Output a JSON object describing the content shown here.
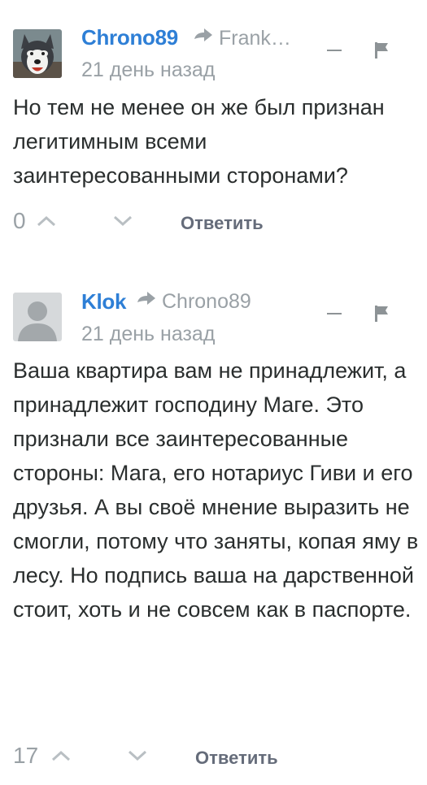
{
  "comments": [
    {
      "author": "Chrono89",
      "reply_to": "Frank…",
      "timestamp": "21 день назад",
      "text": "Но тем не менее он же был признан легитимным всеми заинтересованными сторонами?",
      "votes": "0",
      "reply_label": "Ответить",
      "avatar_icon": "husky-dog-avatar"
    },
    {
      "author": "Klok",
      "reply_to": "Chrono89",
      "timestamp": "21 день назад",
      "text": "Ваша квартира вам не принадлежит, а принадлежит господину Маге. Это признали все заинтересованные стороны: Мага, его нотариус Гиви и его друзья. А вы своё мнение выразить не смогли, потому что заняты, копая яму в лесу. Но подпись ваша на дарственной стоит, хоть и не совсем как в паспорте.",
      "votes": "17",
      "reply_label": "Ответить",
      "avatar_icon": "default-user-avatar"
    }
  ],
  "colors": {
    "author": "#2e7fd6",
    "muted": "#9aa1a6",
    "text": "#2a2e2e",
    "action": "#656c7a"
  }
}
